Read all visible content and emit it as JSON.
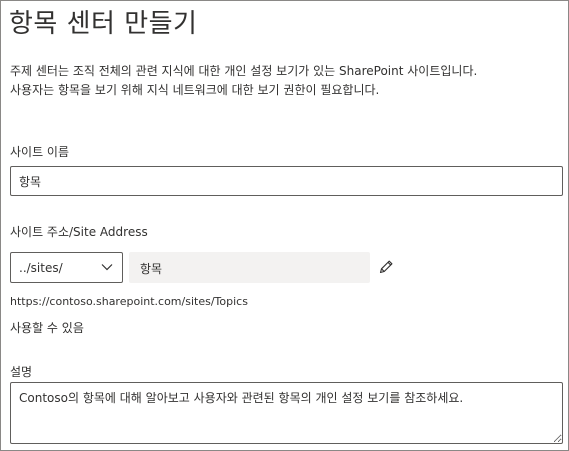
{
  "page": {
    "title": "항목 센터 만들기",
    "description": "주제 센터는 조직 전체의 관련 지식에 대한 개인 설정 보기가 있는 SharePoint 사이트입니다. 사용자는 항목을 보기 위해 지식 네트워크에 대한 보기 권한이 필요합니다."
  },
  "site_name": {
    "label": "사이트 이름",
    "value": "항목"
  },
  "site_address": {
    "label": "사이트 주소/Site Address",
    "path_select_value": "../sites/",
    "url_segment": "항목",
    "full_url": "https://contoso.sharepoint.com/sites/Topics",
    "availability": "사용할 수 있음"
  },
  "description_field": {
    "label": "설명",
    "value": "Contoso의 항목에 대해 알아보고 사용자와 관련된 항목의 개인 설정 보기를 참조하세요."
  },
  "icons": {
    "dropdown": "chevron-down-icon",
    "edit": "pencil-icon"
  }
}
